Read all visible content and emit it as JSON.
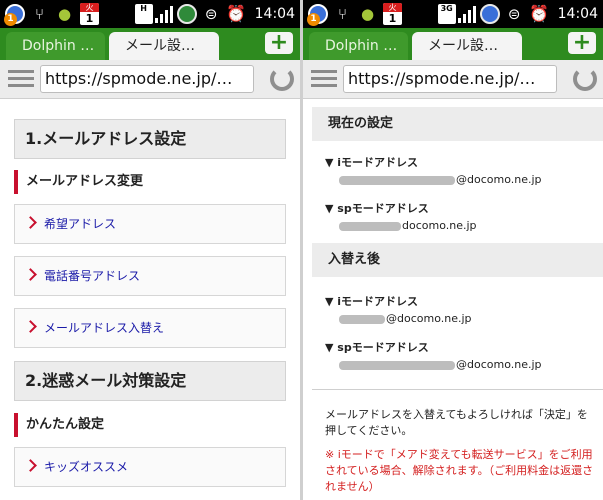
{
  "statusbar": {
    "info_badge": "1",
    "calendar_day_label": "火",
    "calendar_day_number": "1",
    "left_network_label": "H",
    "right_network_label": "3G",
    "time": "14:04"
  },
  "browser": {
    "tab_inactive": "Dolphin …",
    "tab_active": "メール設…",
    "plus_label": "+",
    "url": "https://spmode.ne.jp/…"
  },
  "left": {
    "section1_title": "1.メールアドレス設定",
    "subhead1": "メールアドレス変更",
    "link1": "希望アドレス",
    "link2": "電話番号アドレス",
    "link3": "メールアドレス入替え",
    "section2_title": "2.迷惑メール対策設定",
    "subhead2": "かんたん設定",
    "link4": "キッズオススメ"
  },
  "right": {
    "current_title": "現在の設定",
    "current_imode_label": "▼ iモードアドレス",
    "current_imode_value": "@docomo.ne.jp",
    "current_sp_label": "▼ spモードアドレス",
    "current_sp_value": "docomo.ne.jp",
    "after_title": "入替え後",
    "after_imode_label": "▼ iモードアドレス",
    "after_imode_value": "@docomo.ne.jp",
    "after_sp_label": "▼ spモードアドレス",
    "after_sp_value": "@docomo.ne.jp",
    "confirm_text": "メールアドレスを入替えてもよろしければ「決定」を押してください。",
    "note_text": "※ iモードで「メアド変えても転送サービス」をご利用されている場合、解除されます。（ご利用料金は返還されません）"
  },
  "colors": {
    "tab_green": "#2e8b1f",
    "accent_red": "#c8102e",
    "link_blue": "#1a1aa8",
    "note_red": "#d42020"
  }
}
